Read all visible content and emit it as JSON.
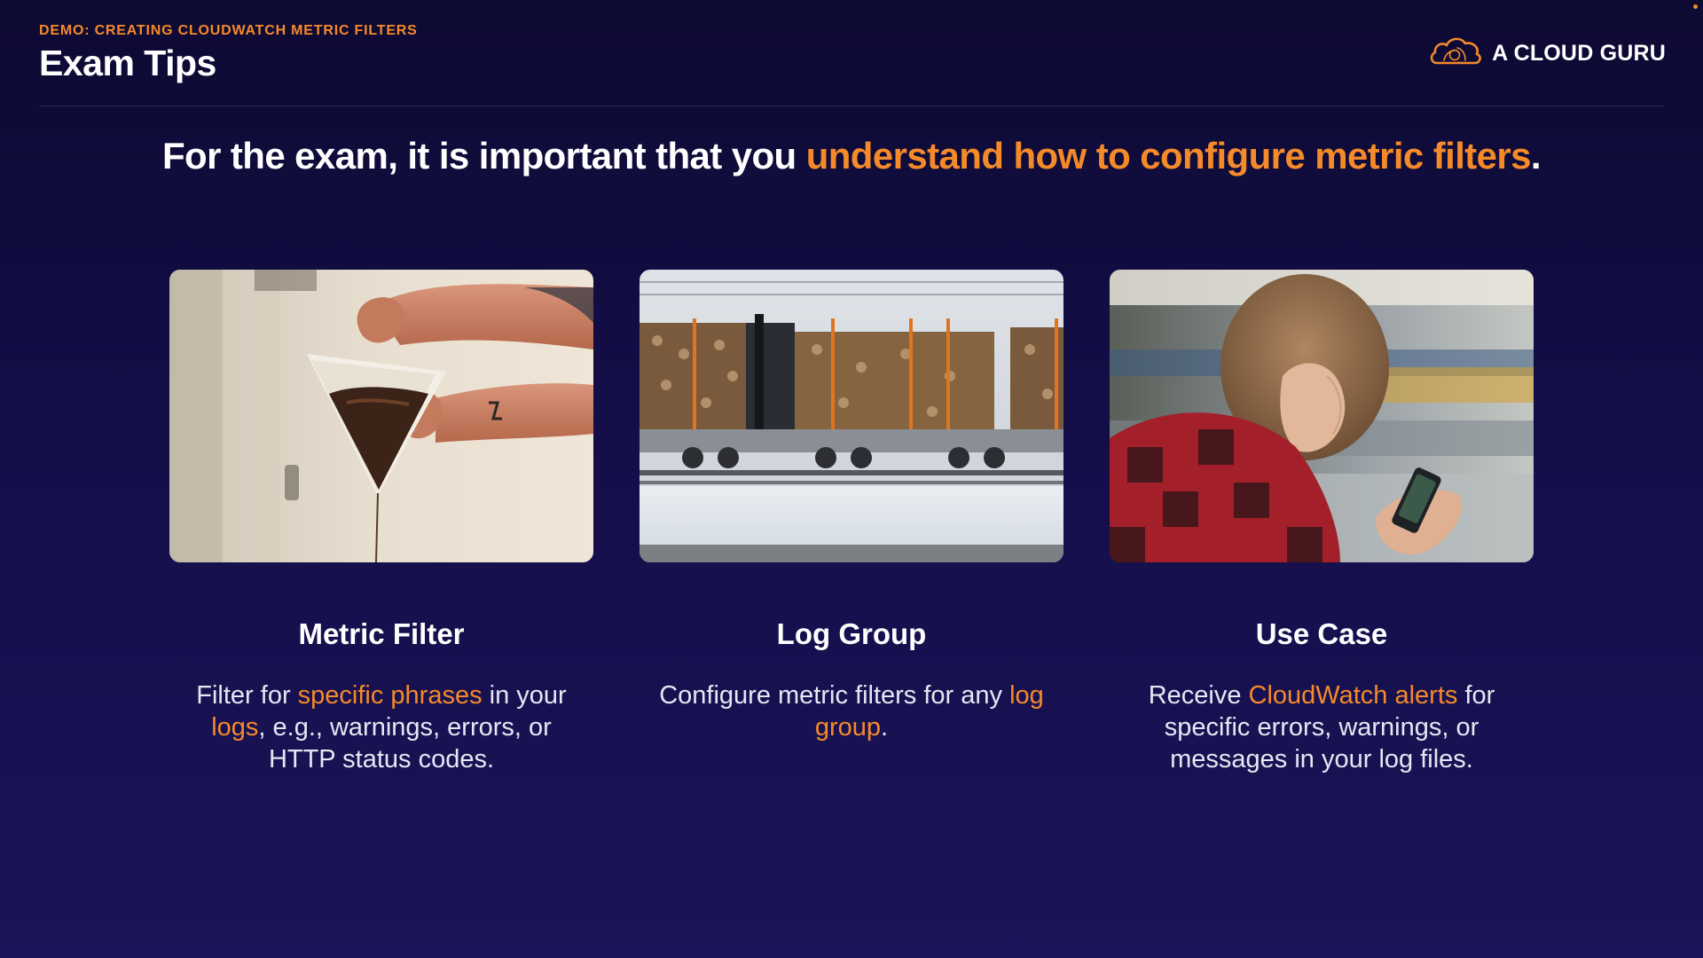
{
  "header": {
    "eyebrow": "DEMO: CREATING CLOUDWATCH METRIC FILTERS",
    "title": "Exam Tips"
  },
  "brand": {
    "name": "A CLOUD GURU",
    "icon": "cloud-logo-icon"
  },
  "headline": {
    "plain_1": "For the exam, it is important that you ",
    "highlight": "understand how to configure metric filters",
    "plain_2": "."
  },
  "cards": [
    {
      "image": "coffee-filter-photo",
      "title": "Metric Filter",
      "desc": [
        {
          "text": "Filter for ",
          "accent": false
        },
        {
          "text": "specific phrases",
          "accent": true
        },
        {
          "text": " in your ",
          "accent": false
        },
        {
          "text": "logs",
          "accent": true
        },
        {
          "text": ", e.g., warnings, errors, or HTTP status codes.",
          "accent": false
        }
      ]
    },
    {
      "image": "log-train-photo",
      "title": "Log Group",
      "desc": [
        {
          "text": "Configure metric filters for any ",
          "accent": false
        },
        {
          "text": "log group",
          "accent": true
        },
        {
          "text": ".",
          "accent": false
        }
      ]
    },
    {
      "image": "woman-phone-photo",
      "title": "Use Case",
      "desc": [
        {
          "text": "Receive ",
          "accent": false
        },
        {
          "text": "CloudWatch alerts",
          "accent": true
        },
        {
          "text": " for specific errors, warnings, or messages in your log files.",
          "accent": false
        }
      ]
    }
  ],
  "colors": {
    "accent": "#f48a2a",
    "background_top": "#0d0a33",
    "background_bottom": "#1b1458",
    "text": "#ffffff"
  }
}
